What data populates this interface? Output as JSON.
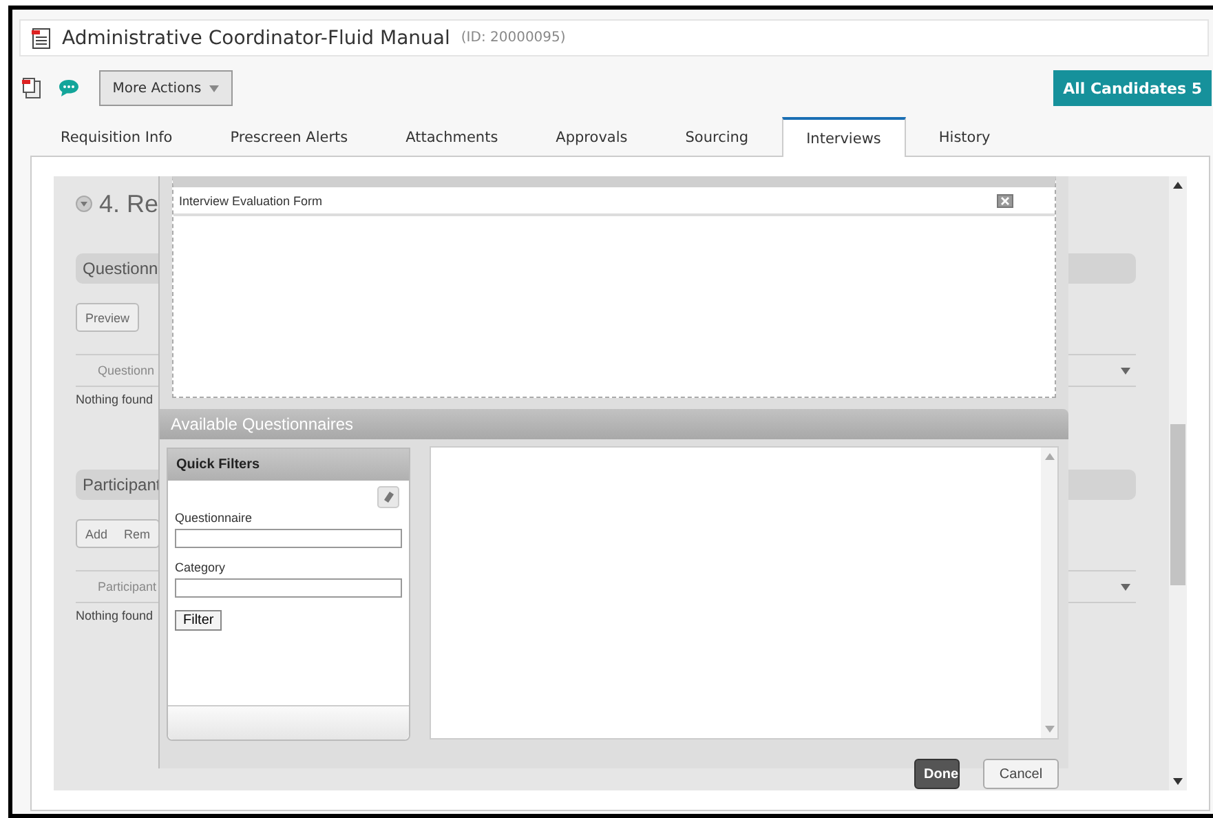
{
  "page": {
    "title": "Administrative Coordinator-Fluid Manual",
    "id_label": "(ID: 20000095)"
  },
  "toolbar": {
    "more_actions": "More Actions",
    "all_candidates": "All Candidates 5"
  },
  "tabs": [
    {
      "label": "Requisition Info",
      "selected": false
    },
    {
      "label": "Prescreen Alerts",
      "selected": false
    },
    {
      "label": "Attachments",
      "selected": false
    },
    {
      "label": "Approvals",
      "selected": false
    },
    {
      "label": "Sourcing",
      "selected": false
    },
    {
      "label": "Interviews",
      "selected": true
    },
    {
      "label": "History",
      "selected": false
    }
  ],
  "section": {
    "heading": "4. Re",
    "groups": [
      {
        "title": "Questionn",
        "buttons": [
          "Preview"
        ],
        "column": "Questionn",
        "empty": "Nothing found"
      },
      {
        "title": "Participant",
        "buttons": [
          "Add",
          "Rem"
        ],
        "column": "Participant",
        "empty": "Nothing found"
      }
    ]
  },
  "dialog": {
    "form": {
      "title": "Interview Evaluation Form"
    },
    "available": {
      "title": "Available Questionnaires",
      "quick_filters": {
        "title": "Quick Filters",
        "fields": [
          {
            "label": "Questionnaire"
          },
          {
            "label": "Category"
          }
        ],
        "filter_button": "Filter"
      }
    },
    "buttons": [
      {
        "label": "Done",
        "kind": "primary"
      },
      {
        "label": "Cancel",
        "kind": "secondary"
      }
    ]
  }
}
